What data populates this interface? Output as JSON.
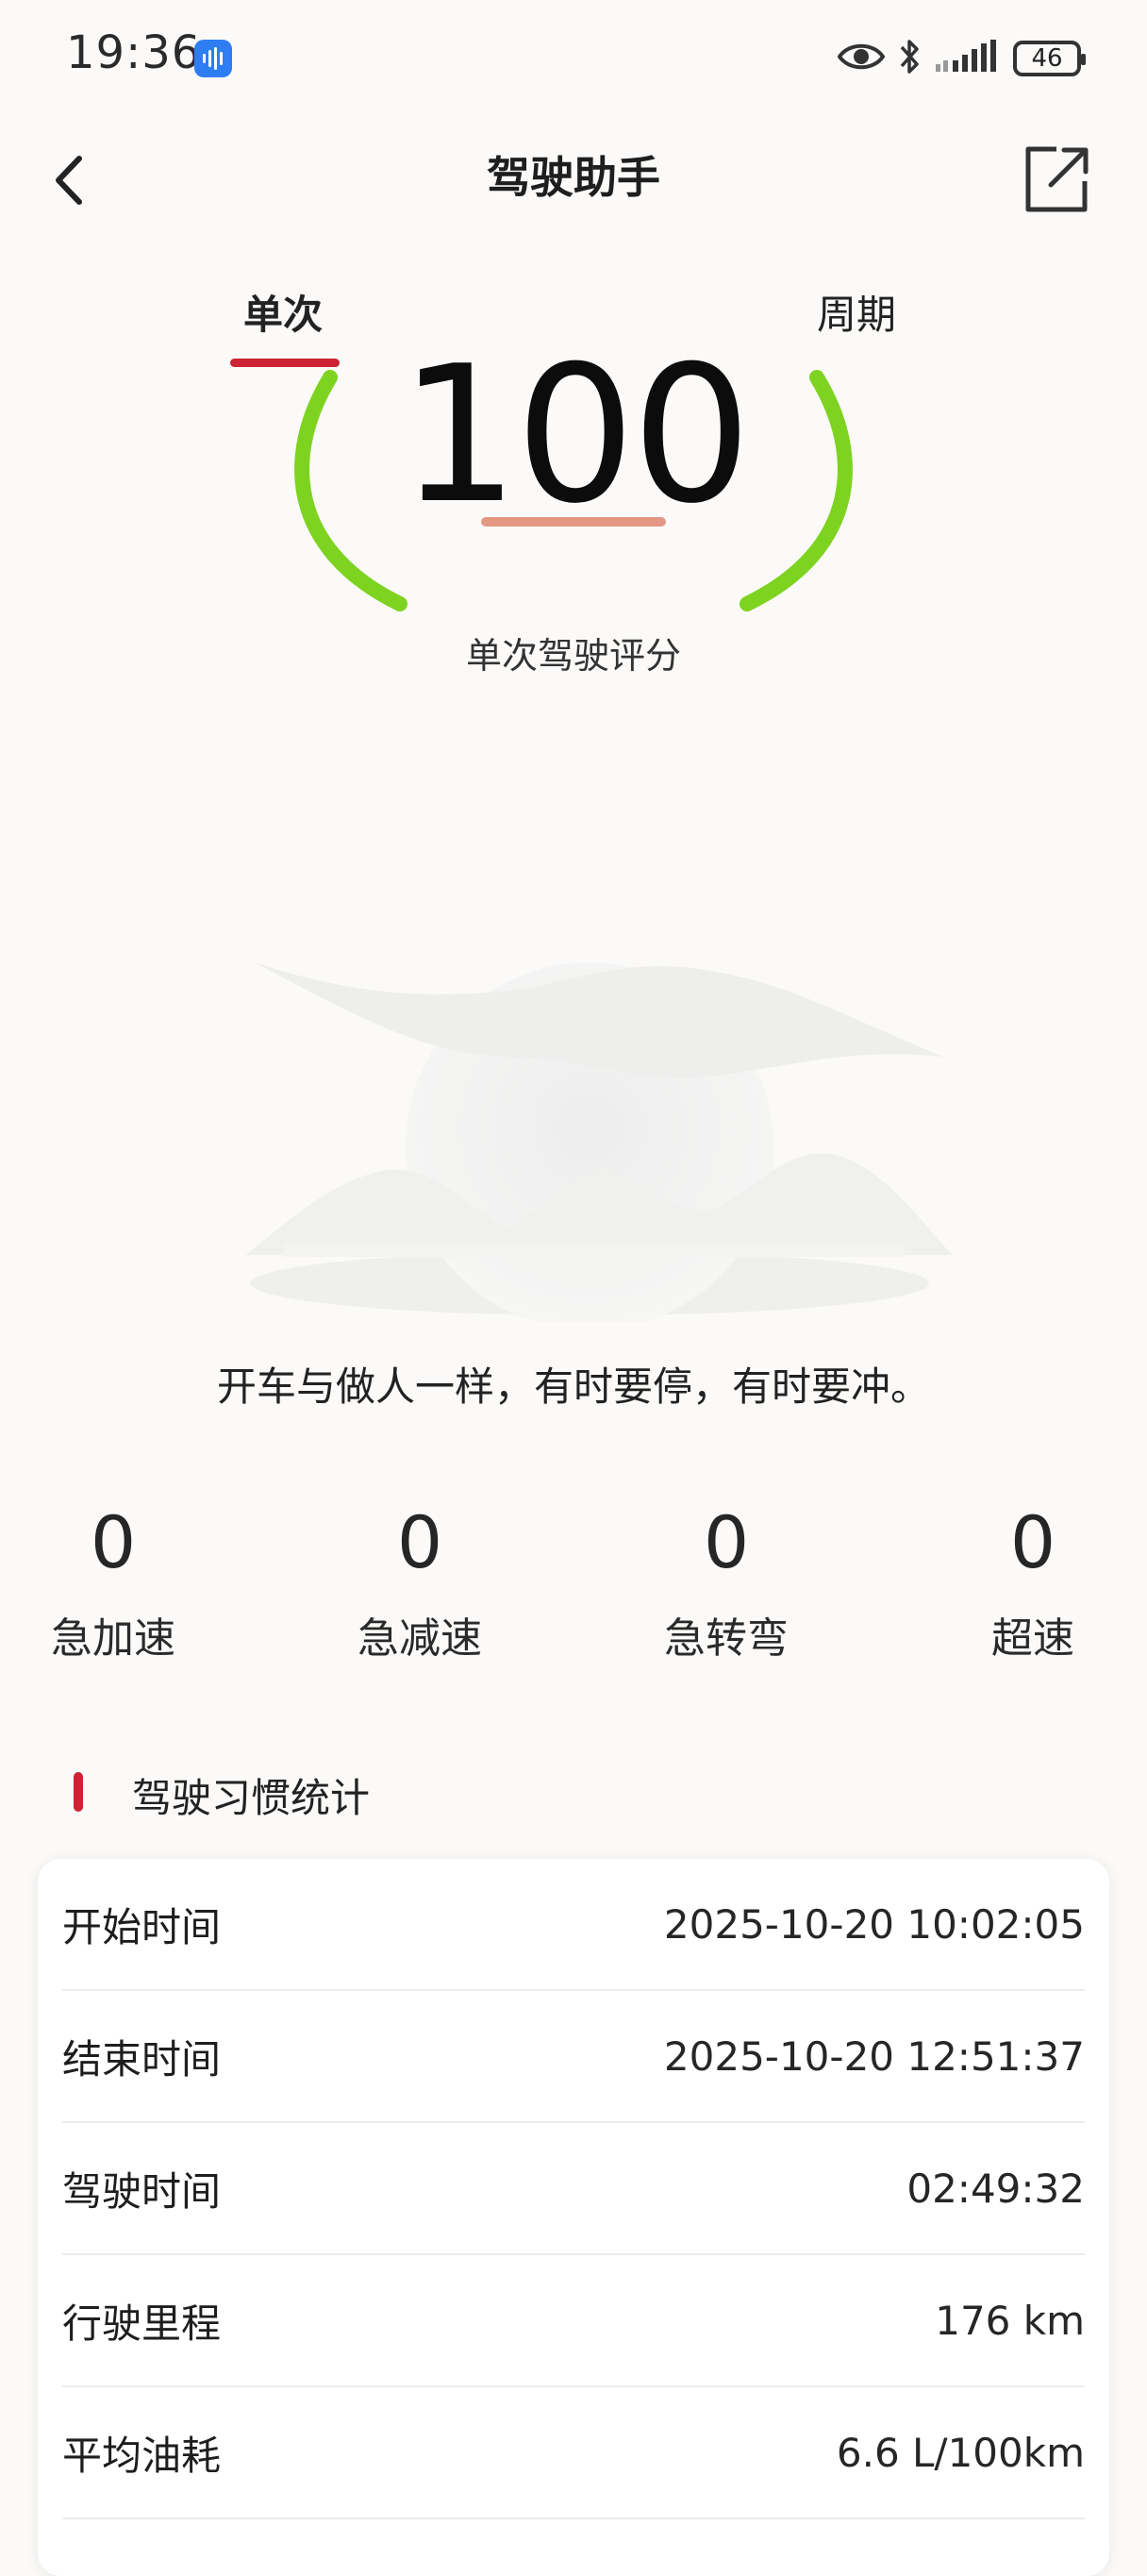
{
  "status_bar": {
    "time": "19:36",
    "battery": "46",
    "icons": [
      "voice-app-icon",
      "eye-icon",
      "bluetooth-icon",
      "signal-icon",
      "battery-icon"
    ]
  },
  "header": {
    "title": "驾驶助手",
    "icons": [
      "back-arrow-icon",
      "share-external-icon"
    ]
  },
  "tabs": [
    {
      "label": "单次",
      "selected": true
    },
    {
      "label": "周期",
      "selected": false
    }
  ],
  "score": {
    "value": "100",
    "label": "单次驾驶评分"
  },
  "motto": "开车与做人一样，有时要停，有时要冲。",
  "events": [
    {
      "value": "0",
      "label": "急加速"
    },
    {
      "value": "0",
      "label": "急减速"
    },
    {
      "value": "0",
      "label": "急转弯"
    },
    {
      "value": "0",
      "label": "超速"
    }
  ],
  "habits": {
    "title": "驾驶习惯统计",
    "rows": [
      {
        "label": "开始时间",
        "value": "2025-10-20 10:02:05"
      },
      {
        "label": "结束时间",
        "value": "2025-10-20 12:51:37"
      },
      {
        "label": "驾驶时间",
        "value": "02:49:32"
      },
      {
        "label": "行驶里程",
        "value": "176 km"
      },
      {
        "label": "平均油耗",
        "value": "6.6 L/100km"
      }
    ]
  },
  "colors": {
    "accent": "#cc2233",
    "score_arc": "#7ed321",
    "score_underline": "#e29883",
    "background": "#fbfaf8"
  }
}
